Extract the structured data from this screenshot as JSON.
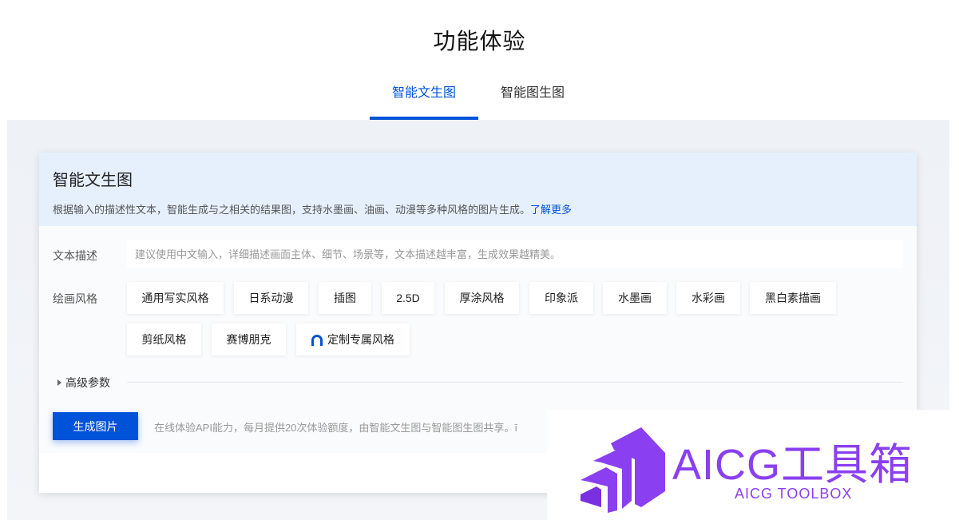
{
  "page": {
    "title": "功能体验"
  },
  "tabs": [
    {
      "label": "智能文生图",
      "active": true
    },
    {
      "label": "智能图生图",
      "active": false
    }
  ],
  "card": {
    "title": "智能文生图",
    "description": "根据输入的描述性文本，智能生成与之相关的结果图，支持水墨画、油画、动漫等多种风格的图片生成。",
    "learn_more": "了解更多"
  },
  "form": {
    "text_label": "文本描述",
    "text_placeholder": "建议使用中文输入，详细描述画面主体、细节、场景等，文本描述越丰富，生成效果越精美。",
    "style_label": "绘画风格",
    "styles": [
      "通用写实风格",
      "日系动漫",
      "插图",
      "2.5D",
      "厚涂风格",
      "印象派",
      "水墨画",
      "水彩画",
      "黑白素描画",
      "剪纸风格",
      "赛博朋克",
      "定制专属风格"
    ],
    "advanced_label": "高级参数",
    "generate_label": "生成图片",
    "generate_note": "在线体验API能力，每月提供20次体验额度，由智能文生图与智能图生图共享。ī"
  },
  "watermark": {
    "title": "AICG工具箱",
    "subtitle": "AICG TOOLBOX"
  },
  "colors": {
    "accent": "#0052d9",
    "header_bg": "#e6f0fd",
    "watermark": "#8a3ff0"
  }
}
